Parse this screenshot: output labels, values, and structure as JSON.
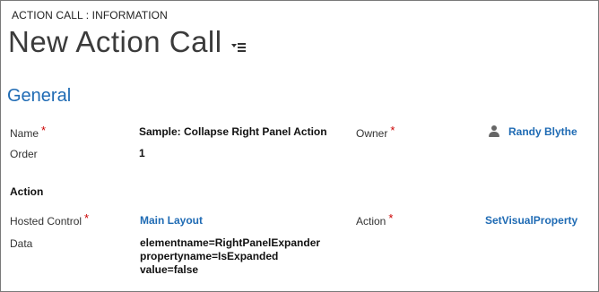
{
  "header": {
    "entity_label": "ACTION CALL : INFORMATION",
    "title": "New Action Call"
  },
  "section": {
    "title": "General"
  },
  "fields": {
    "name": {
      "label": "Name",
      "required_mark": "*",
      "value": "Sample: Collapse Right Panel Action"
    },
    "owner": {
      "label": "Owner",
      "required_mark": "*",
      "value": "Randy Blythe",
      "icon": "person-icon"
    },
    "order": {
      "label": "Order",
      "value": "1"
    },
    "action_subheading": "Action",
    "hosted_control": {
      "label": "Hosted Control",
      "required_mark": "*",
      "value": "Main Layout"
    },
    "action": {
      "label": "Action",
      "required_mark": "*",
      "value": "SetVisualProperty"
    },
    "data": {
      "label": "Data",
      "lines": [
        "elementname=RightPanelExpander",
        "propertyname=IsExpanded",
        "value=false"
      ]
    }
  },
  "colors": {
    "link": "#1f6bb4",
    "required": "#cc0000",
    "section_title": "#1f6bb4"
  }
}
